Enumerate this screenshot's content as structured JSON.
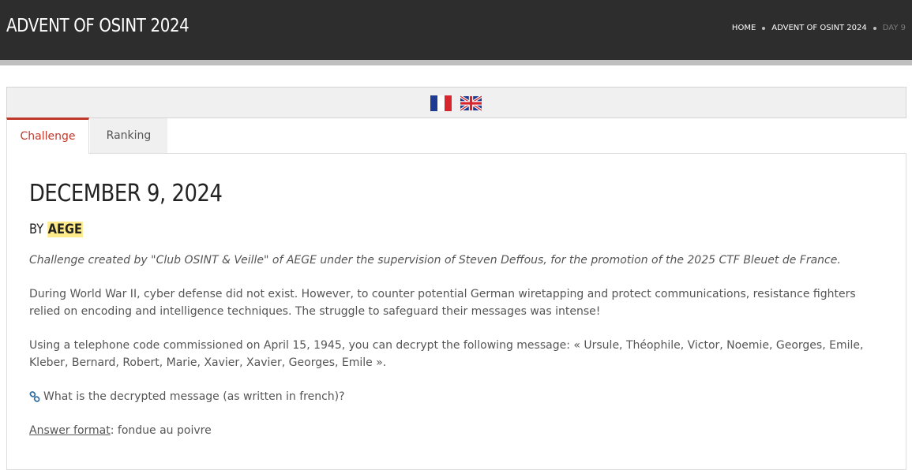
{
  "header": {
    "site_title": "ADVENT OF OSINT 2024",
    "breadcrumb": [
      "HOME",
      "ADVENT OF OSINT 2024",
      "DAY 9"
    ]
  },
  "languages": [
    "fr-flag-icon",
    "uk-flag-icon"
  ],
  "tabs": [
    {
      "label": "Challenge",
      "active": true
    },
    {
      "label": "Ranking",
      "active": false
    }
  ],
  "challenge": {
    "date": "DECEMBER 9, 2024",
    "by_prefix": "BY",
    "author": "AEGE",
    "intro": "Challenge created by \"Club OSINT & Veille\" of AEGE under the supervision of Steven Deffous, for the promotion of the 2025 CTF Bleuet de France.",
    "paragraph_1": "During World War II, cyber defense did not exist. However, to counter potential German wiretapping and protect communications, resistance fighters relied on encoding and intelligence techniques. The struggle to safeguard their messages was intense!",
    "paragraph_2": "Using a telephone code commissioned on April 15, 1945, you can decrypt the following message: « Ursule, Théophile, Victor, Noemie, Georges, Emile, Kleber, Bernard, Robert, Marie, Xavier, Xavier, Georges, Emile ».",
    "question": "What is the decrypted message (as written in french)?",
    "answer_label": "Answer format",
    "answer_value": ": fondue au poivre"
  },
  "colors": {
    "header_bg": "#2d2d2d",
    "accent": "#c0392b",
    "highlight": "#ffeb8a",
    "link": "#2e6da4"
  }
}
